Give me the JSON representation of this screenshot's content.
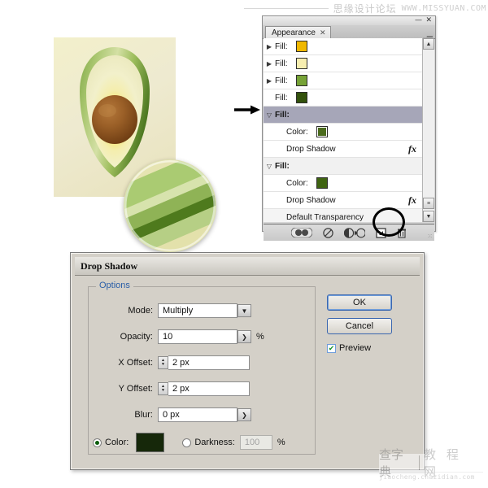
{
  "watermarks": {
    "top_cn": "思缘设计论坛",
    "top_url": "WWW.MISSYUAN.COM",
    "bottom_cn_left": "查字典",
    "bottom_cn_right": "教 程 网",
    "bottom_url": "jiaocheng.chazidian.com"
  },
  "artwork": {
    "name": "avocado-illustration",
    "background_color": "#eeead0",
    "skin_outer": "#6d9b3f",
    "skin_mid": "#a8c46b",
    "skin_light": "#cfdd9a",
    "flesh_color": "#f3efc4",
    "flesh_ring": "#f2d84a",
    "pit_color": "#8d5223",
    "loupe_label": "zoom-detail-loupe"
  },
  "panel": {
    "title": "Appearance",
    "tab_close": "✕",
    "minimize": "—",
    "close": "✕",
    "menu_icon": "panel-menu-icon",
    "rows": [
      {
        "id": "fill-1",
        "triangle": "▶",
        "label": "Fill:",
        "swatch": "#f0b800",
        "state": "collapsed",
        "effect": null
      },
      {
        "id": "fill-2",
        "triangle": "▶",
        "label": "Fill:",
        "swatch": "#f7eeb0",
        "state": "collapsed",
        "effect": null
      },
      {
        "id": "fill-3",
        "triangle": "▶",
        "label": "Fill:",
        "swatch": "#76a236",
        "state": "collapsed",
        "effect": null
      },
      {
        "id": "fill-4",
        "triangle": "",
        "label": "Fill:",
        "swatch": "#33520c",
        "state": "leaf",
        "effect": null
      }
    ],
    "expanded_fills": [
      {
        "id": "fill-5",
        "triangle": "▽",
        "label": "Fill:",
        "selected": true,
        "color_label": "Color:",
        "color_swatch": "#4b6b1e",
        "effect_label": "Drop Shadow",
        "effect_icon": "fx"
      },
      {
        "id": "fill-6",
        "triangle": "▽",
        "label": "Fill:",
        "selected": false,
        "color_label": "Color:",
        "color_swatch": "#3f6412",
        "effect_label": "Drop Shadow",
        "effect_icon": "fx"
      }
    ],
    "footer_row_label": "Default Transparency",
    "footer_icons": [
      {
        "name": "new-art-has-basic-appearance-icon",
        "glyph": "◖◗"
      },
      {
        "name": "clear-appearance-icon",
        "glyph": "⊘"
      },
      {
        "name": "reduce-to-basic-appearance-icon",
        "glyph": "◑▸◯"
      },
      {
        "name": "duplicate-selected-item-icon",
        "glyph": "❏",
        "highlighted": true
      },
      {
        "name": "delete-selected-item-icon",
        "glyph": "🗑"
      }
    ],
    "scrollbar": {
      "up_arrow": "▲",
      "down_arrow": "▼",
      "grip": "≡"
    },
    "pointer_annotation": "black-arrow-pointing-to-selected-fill"
  },
  "dialog": {
    "title": "Drop Shadow",
    "options_legend": "Options",
    "fields": [
      {
        "name": "mode",
        "label": "Mode:",
        "value": "Multiply",
        "control": "dropdown",
        "suffix": ""
      },
      {
        "name": "opacity",
        "label": "Opacity:",
        "value": "10",
        "control": "stepper-right",
        "suffix": "%"
      },
      {
        "name": "x-offset",
        "label": "X Offset:",
        "value": "2 px",
        "control": "spinner-left",
        "suffix": ""
      },
      {
        "name": "y-offset",
        "label": "Y Offset:",
        "value": "2 px",
        "control": "spinner-left",
        "suffix": ""
      },
      {
        "name": "blur",
        "label": "Blur:",
        "value": "0 px",
        "control": "stepper-right",
        "suffix": ""
      }
    ],
    "color_radio": {
      "label": "Color:",
      "selected": true,
      "swatch": "#16280a"
    },
    "darkness_radio": {
      "label": "Darkness:",
      "selected": false,
      "value": "100",
      "suffix": "%",
      "disabled": true
    },
    "buttons": {
      "ok": "OK",
      "cancel": "Cancel"
    },
    "preview": {
      "label": "Preview",
      "checked": true,
      "check_glyph": "✔"
    }
  }
}
